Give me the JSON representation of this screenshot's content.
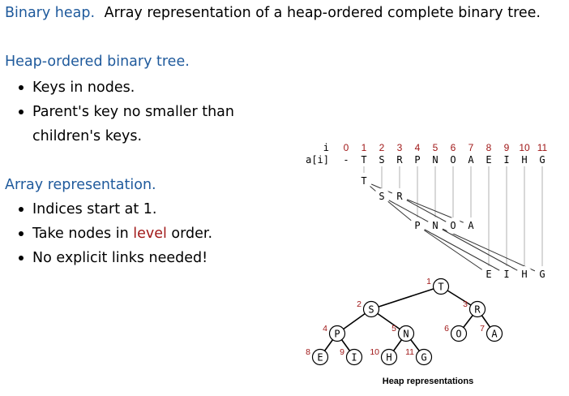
{
  "title": {
    "term": "Binary heap.",
    "text": "Array representation of a heap-ordered complete binary tree."
  },
  "section1": {
    "heading": "Heap-ordered binary tree.",
    "bullets": [
      "Keys in nodes.",
      "Parent's key no smaller than",
      "children's keys."
    ]
  },
  "section2": {
    "heading": "Array representation.",
    "bullet1": "Indices start at 1.",
    "bullet2_pre": "Take nodes in ",
    "bullet2_em": "level",
    "bullet2_post": " order.",
    "bullet3": "No explicit links needed!"
  },
  "array": {
    "index_label": "i",
    "value_label": "a[i]",
    "indices": [
      "0",
      "1",
      "2",
      "3",
      "4",
      "5",
      "6",
      "7",
      "8",
      "9",
      "10",
      "11"
    ],
    "values": [
      "-",
      "T",
      "S",
      "R",
      "P",
      "N",
      "O",
      "A",
      "E",
      "I",
      "H",
      "G"
    ]
  },
  "tree": {
    "nodes": [
      {
        "i": 1,
        "key": "T"
      },
      {
        "i": 2,
        "key": "S"
      },
      {
        "i": 3,
        "key": "R"
      },
      {
        "i": 4,
        "key": "P"
      },
      {
        "i": 5,
        "key": "N"
      },
      {
        "i": 6,
        "key": "O"
      },
      {
        "i": 7,
        "key": "A"
      },
      {
        "i": 8,
        "key": "E"
      },
      {
        "i": 9,
        "key": "I"
      },
      {
        "i": 10,
        "key": "H"
      },
      {
        "i": 11,
        "key": "G"
      }
    ]
  },
  "caption": "Heap representations",
  "colors": {
    "heading": "#1f5a9c",
    "index": "#a01818",
    "edge": "#000000",
    "guide": "#b0b0b0"
  }
}
